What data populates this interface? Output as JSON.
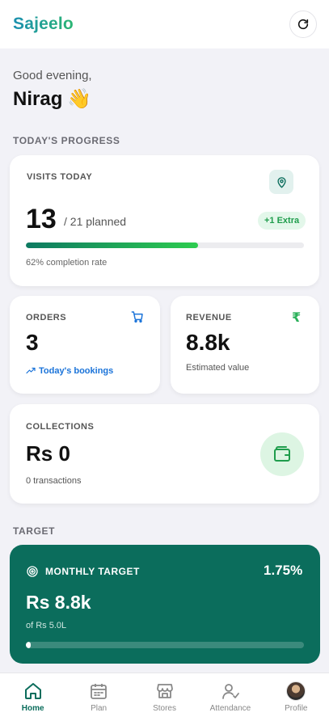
{
  "header": {
    "logo": "Sajeelo"
  },
  "greeting": {
    "text": "Good evening,",
    "name": "Nirag",
    "emoji": "👋"
  },
  "sections": {
    "progress": "TODAY'S PROGRESS",
    "target": "TARGET"
  },
  "visits": {
    "label": "VISITS TODAY",
    "count": "13",
    "planned": "/ 21 planned",
    "extra_badge": "+1 Extra",
    "completion_fraction": 0.62,
    "completion_text": "62% completion rate"
  },
  "orders": {
    "label": "ORDERS",
    "count": "3",
    "sub": "Today's bookings"
  },
  "revenue": {
    "label": "REVENUE",
    "symbol": "₹",
    "value": "8.8k",
    "sub": "Estimated value"
  },
  "collections": {
    "label": "COLLECTIONS",
    "value": "Rs 0",
    "sub": "0 transactions"
  },
  "target": {
    "label": "MONTHLY TARGET",
    "percent": "1.75%",
    "percent_fraction": 0.0175,
    "value": "Rs 8.8k",
    "sub": "of Rs 5.0L"
  },
  "nav": [
    {
      "label": "Home",
      "icon": "home-icon",
      "active": true
    },
    {
      "label": "Plan",
      "icon": "calendar-icon",
      "active": false
    },
    {
      "label": "Stores",
      "icon": "store-icon",
      "active": false
    },
    {
      "label": "Attendance",
      "icon": "user-check-icon",
      "active": false
    },
    {
      "label": "Profile",
      "icon": "avatar",
      "active": false
    }
  ],
  "colors": {
    "brand": "#0b6d5c",
    "accent_green": "#2dcc4f",
    "link_blue": "#1a73d9"
  }
}
